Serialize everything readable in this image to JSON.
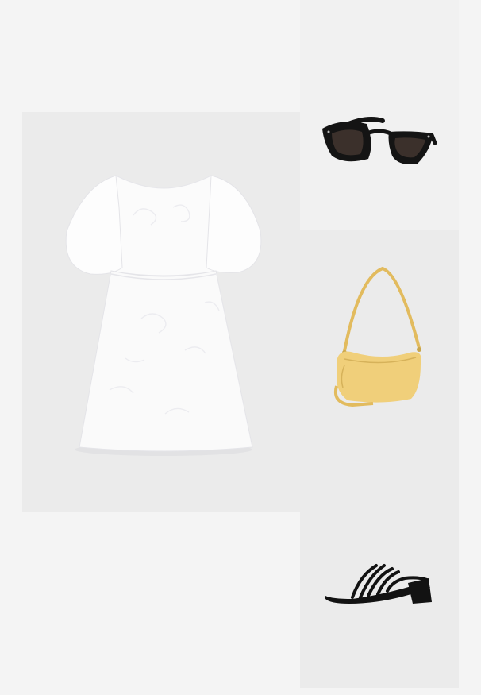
{
  "board": {
    "background": "#f4f4f4",
    "items": [
      {
        "name": "dress",
        "color": "#fbfbfb",
        "shadow": "#e2e2e4"
      },
      {
        "name": "sunglasses",
        "frame_color": "#141414",
        "lens_color": "#3b302b"
      },
      {
        "name": "shoulder-bag",
        "color": "#f0cf7a",
        "strap_color": "#e2bb5e"
      },
      {
        "name": "sandals",
        "color": "#121212"
      }
    ]
  }
}
